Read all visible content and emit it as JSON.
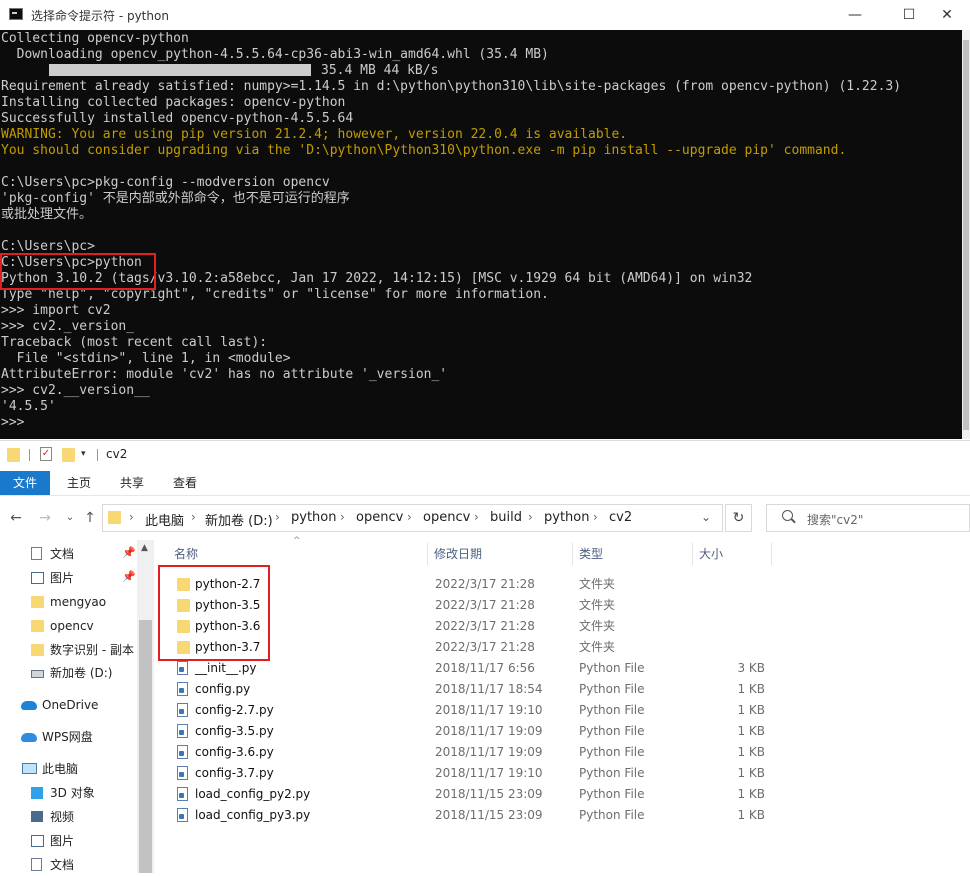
{
  "console_window": {
    "title": "选择命令提示符 - python",
    "buttons": {
      "minimize": "—",
      "maximize": "☐",
      "close": "✕"
    },
    "lines": [
      "Collecting opencv-python",
      "  Downloading opencv_python-4.5.5.64-cp36-abi3-win_amd64.whl (35.4 MB)",
      "     |████████████████████████████████| 35.4 MB 44 kB/s",
      "Requirement already satisfied: numpy>=1.14.5 in d:\\python\\python310\\lib\\site-packages (from opencv-python) (1.22.3)",
      "Installing collected packages: opencv-python",
      "Successfully installed opencv-python-4.5.5.64",
      "WARNING: You are using pip version 21.2.4; however, version 22.0.4 is available.",
      "You should consider upgrading via the 'D:\\python\\Python310\\python.exe -m pip install --upgrade pip' command.",
      "",
      "C:\\Users\\pc>pkg-config --modversion opencv",
      "'pkg-config' 不是内部或外部命令，也不是可运行的程序",
      "或批处理文件。",
      "",
      "C:\\Users\\pc>",
      "C:\\Users\\pc>python",
      "Python 3.10.2 (tags/v3.10.2:a58ebcc, Jan 17 2022, 14:12:15) [MSC v.1929 64 bit (AMD64)] on win32",
      "Type \"help\", \"copyright\", \"credits\" or \"license\" for more information.",
      ">>> import cv2",
      ">>> cv2._version_",
      "Traceback (most recent call last):",
      "  File \"<stdin>\", line 1, in <module>",
      "AttributeError: module 'cv2' has no attribute '_version_'",
      ">>> cv2.__version__",
      "'4.5.5'",
      ">>>"
    ],
    "progress_text": "35.4 MB 44 kB/s",
    "progress_fraction": 1.0
  },
  "explorer": {
    "quick_access_title": "cv2",
    "ribbon_tabs": [
      "文件",
      "主页",
      "共享",
      "查看"
    ],
    "breadcrumbs": [
      "此电脑",
      "新加卷 (D:)",
      "python",
      "opencv",
      "opencv",
      "build",
      "python",
      "cv2"
    ],
    "search_placeholder": "搜索\"cv2\"",
    "nav_items": [
      {
        "label": "文档",
        "icon": "document-icon"
      },
      {
        "label": "图片",
        "icon": "picture-icon"
      },
      {
        "label": "mengyao",
        "icon": "folder-icon"
      },
      {
        "label": "opencv",
        "icon": "folder-icon"
      },
      {
        "label": "数字识别 - 副本",
        "icon": "folder-icon"
      },
      {
        "label": "新加卷 (D:)",
        "icon": "drive-icon"
      },
      {
        "label": "OneDrive",
        "icon": "onedrive-icon"
      },
      {
        "label": "WPS网盘",
        "icon": "cloud-icon"
      },
      {
        "label": "此电脑",
        "icon": "computer-icon"
      },
      {
        "label": "3D 对象",
        "icon": "cube-icon"
      },
      {
        "label": "视频",
        "icon": "video-icon"
      },
      {
        "label": "图片",
        "icon": "picture-icon"
      },
      {
        "label": "文档",
        "icon": "document-icon"
      }
    ],
    "columns": {
      "name": "名称",
      "date": "修改日期",
      "type": "类型",
      "size": "大小"
    },
    "files": [
      {
        "name": "python-2.7",
        "date": "2022/3/17 21:28",
        "type": "文件夹",
        "size": "",
        "kind": "folder"
      },
      {
        "name": "python-3.5",
        "date": "2022/3/17 21:28",
        "type": "文件夹",
        "size": "",
        "kind": "folder"
      },
      {
        "name": "python-3.6",
        "date": "2022/3/17 21:28",
        "type": "文件夹",
        "size": "",
        "kind": "folder"
      },
      {
        "name": "python-3.7",
        "date": "2022/3/17 21:28",
        "type": "文件夹",
        "size": "",
        "kind": "folder"
      },
      {
        "name": "__init__.py",
        "date": "2018/11/17 6:56",
        "type": "Python File",
        "size": "3 KB",
        "kind": "py"
      },
      {
        "name": "config.py",
        "date": "2018/11/17 18:54",
        "type": "Python File",
        "size": "1 KB",
        "kind": "py"
      },
      {
        "name": "config-2.7.py",
        "date": "2018/11/17 19:10",
        "type": "Python File",
        "size": "1 KB",
        "kind": "py"
      },
      {
        "name": "config-3.5.py",
        "date": "2018/11/17 19:09",
        "type": "Python File",
        "size": "1 KB",
        "kind": "py"
      },
      {
        "name": "config-3.6.py",
        "date": "2018/11/17 19:09",
        "type": "Python File",
        "size": "1 KB",
        "kind": "py"
      },
      {
        "name": "config-3.7.py",
        "date": "2018/11/17 19:10",
        "type": "Python File",
        "size": "1 KB",
        "kind": "py"
      },
      {
        "name": "load_config_py2.py",
        "date": "2018/11/15 23:09",
        "type": "Python File",
        "size": "1 KB",
        "kind": "py"
      },
      {
        "name": "load_config_py3.py",
        "date": "2018/11/15 23:09",
        "type": "Python File",
        "size": "1 KB",
        "kind": "py"
      }
    ]
  }
}
